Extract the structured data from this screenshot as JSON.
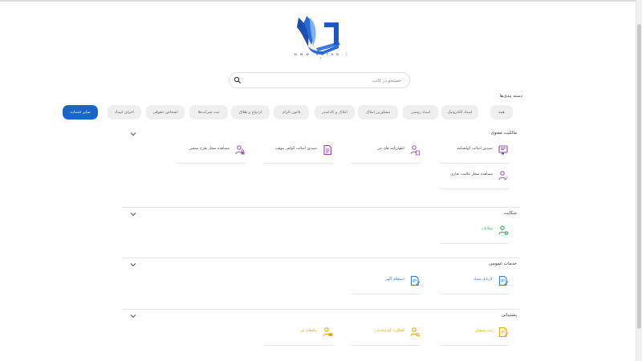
{
  "logo": {
    "url_text": "w w w . k e t a b . i r"
  },
  "search": {
    "placeholder": "جستجو در کاتب"
  },
  "categories_title": "دسته بندی‌ها",
  "categories": [
    {
      "label": "همه",
      "active": false
    },
    {
      "label": "اسناد الکترونیک",
      "active": false
    },
    {
      "label": "اسناد رسمی",
      "active": false
    },
    {
      "label": "مشاورین املاک",
      "active": false
    },
    {
      "label": "املاک و کاداستر",
      "active": false
    },
    {
      "label": "قانون الزام",
      "active": false
    },
    {
      "label": "ازدواج و طلاق",
      "active": false
    },
    {
      "label": "ثبت شرکت‌ها",
      "active": false
    },
    {
      "label": "اشخاص حقوقی",
      "active": false
    },
    {
      "label": "اجرای اسناد",
      "active": false
    },
    {
      "label": "سایر خدمات",
      "active": true
    }
  ],
  "sections": [
    {
      "title": "مالکیت معنوی",
      "items": [
        {
          "label": "تصدیق اصالت گواهینامه",
          "icon": "certificate-icon",
          "color": "#8e44ad"
        },
        {
          "label": "اظهارنامه های من",
          "icon": "user-document-icon",
          "color": "#9b59b6"
        },
        {
          "label": "تصدیق اصالت گواهی موقت",
          "icon": "document-icon",
          "color": "#8e44ad"
        },
        {
          "label": "مشاهده سجل طرح صنعتی",
          "icon": "user-lock-icon",
          "color": "#9b59b6"
        },
        {
          "label": "مشاهده سجل علامت تجاری",
          "icon": "user-edit-icon",
          "color": "#9b59b6"
        }
      ]
    },
    {
      "title": "شکایت",
      "items": [
        {
          "label": "شکایات",
          "icon": "user-add-icon",
          "color": "#27ae60"
        }
      ]
    },
    {
      "title": "خدمات عمومی",
      "items": [
        {
          "label": "کارتابل مصاد",
          "icon": "edit-document-icon",
          "color": "#2b7fd4"
        },
        {
          "label": "استعلام آگهی",
          "icon": "edit-document-icon",
          "color": "#2b7fd4"
        }
      ]
    },
    {
      "title": "پشتیبانی",
      "items": [
        {
          "label": "ثبت پشتیبان",
          "icon": "edit-document-icon",
          "color": "#e0a800"
        },
        {
          "label": "گفتگو با کارشناسان",
          "icon": "user-search-icon",
          "color": "#e0a800"
        },
        {
          "label": "پیام‌های من",
          "icon": "user-message-icon",
          "color": "#e0a800"
        }
      ]
    }
  ]
}
